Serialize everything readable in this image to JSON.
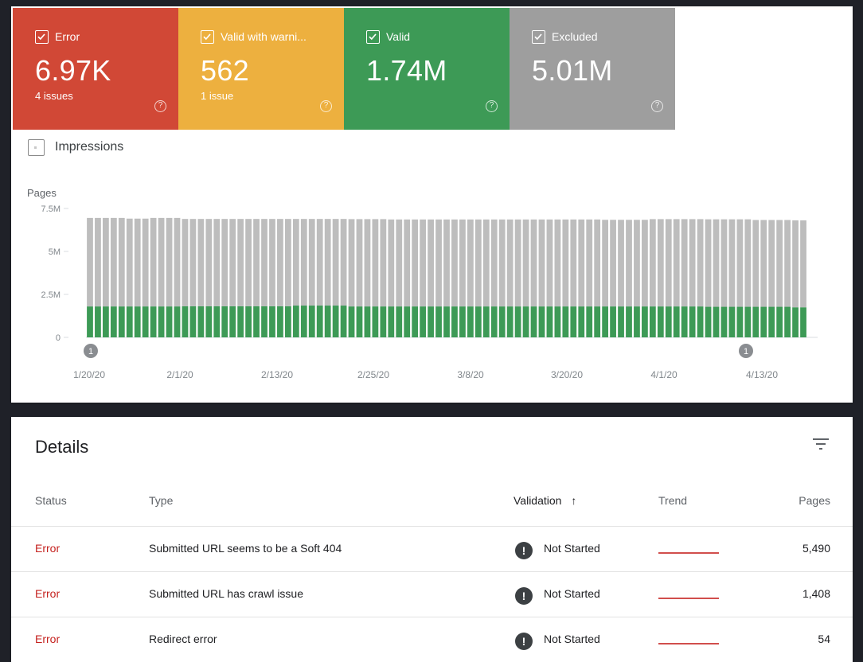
{
  "tiles": [
    {
      "label": "Error",
      "value": "6.97K",
      "sub": "4 issues",
      "color": "#d14836"
    },
    {
      "label": "Valid with warni...",
      "value": "562",
      "sub": "1 issue",
      "color": "#edb03f"
    },
    {
      "label": "Valid",
      "value": "1.74M",
      "sub": "",
      "color": "#3d9a56"
    },
    {
      "label": "Excluded",
      "value": "5.01M",
      "sub": "",
      "color": "#9e9e9e"
    }
  ],
  "impressions_label": "Impressions",
  "chart_data": {
    "type": "bar",
    "stacked": true,
    "ylabel": "Pages",
    "yticks": [
      "7.5M",
      "5M",
      "2.5M",
      "0"
    ],
    "ylim": [
      0,
      7500000
    ],
    "xtick_labels": [
      "1/20/20",
      "2/1/20",
      "2/13/20",
      "2/25/20",
      "3/8/20",
      "3/20/20",
      "4/1/20",
      "4/13/20"
    ],
    "annotation_markers": [
      "1",
      "1"
    ],
    "grid": false,
    "series": [
      {
        "color": "#3d9a56",
        "values": [
          1800000,
          1800000,
          1800000,
          1800000,
          1800000,
          1800000,
          1800000,
          1800000,
          1800000,
          1800000,
          1800000,
          1800000,
          1810000,
          1810000,
          1810000,
          1810000,
          1810000,
          1810000,
          1810000,
          1810000,
          1810000,
          1810000,
          1810000,
          1810000,
          1810000,
          1810000,
          1850000,
          1850000,
          1850000,
          1850000,
          1850000,
          1850000,
          1850000,
          1800000,
          1800000,
          1800000,
          1800000,
          1800000,
          1800000,
          1800000,
          1800000,
          1800000,
          1800000,
          1800000,
          1800000,
          1800000,
          1800000,
          1800000,
          1800000,
          1800000,
          1800000,
          1800000,
          1800000,
          1800000,
          1800000,
          1800000,
          1800000,
          1800000,
          1800000,
          1800000,
          1800000,
          1800000,
          1800000,
          1800000,
          1800000,
          1800000,
          1800000,
          1800000,
          1800000,
          1800000,
          1800000,
          1800000,
          1800000,
          1800000,
          1800000,
          1800000,
          1800000,
          1800000,
          1780000,
          1780000,
          1780000,
          1780000,
          1780000,
          1780000,
          1780000,
          1780000,
          1780000,
          1780000,
          1780000,
          1750000,
          1750000
        ]
      },
      {
        "color": "#bdbdbd",
        "values": [
          5150000,
          5150000,
          5150000,
          5150000,
          5150000,
          5110000,
          5110000,
          5110000,
          5150000,
          5150000,
          5150000,
          5150000,
          5080000,
          5080000,
          5080000,
          5080000,
          5080000,
          5080000,
          5080000,
          5080000,
          5080000,
          5080000,
          5080000,
          5080000,
          5080000,
          5080000,
          5040000,
          5040000,
          5040000,
          5040000,
          5040000,
          5040000,
          5040000,
          5080000,
          5080000,
          5080000,
          5080000,
          5080000,
          5060000,
          5060000,
          5060000,
          5060000,
          5060000,
          5060000,
          5060000,
          5060000,
          5060000,
          5060000,
          5060000,
          5060000,
          5060000,
          5060000,
          5060000,
          5060000,
          5060000,
          5060000,
          5060000,
          5060000,
          5060000,
          5060000,
          5060000,
          5060000,
          5060000,
          5060000,
          5060000,
          5040000,
          5040000,
          5040000,
          5040000,
          5040000,
          5040000,
          5080000,
          5080000,
          5080000,
          5080000,
          5080000,
          5080000,
          5080000,
          5090000,
          5090000,
          5090000,
          5090000,
          5090000,
          5090000,
          5050000,
          5050000,
          5050000,
          5050000,
          5050000,
          5060000,
          5060000
        ]
      }
    ]
  },
  "details": {
    "title": "Details",
    "columns": {
      "status": "Status",
      "type": "Type",
      "validation": "Validation",
      "sort_icon": "↑",
      "trend": "Trend",
      "pages": "Pages"
    },
    "rows": [
      {
        "status": "Error",
        "type": "Submitted URL seems to be a Soft 404",
        "validation_icon": "!",
        "validation": "Not Started",
        "pages": "5,490"
      },
      {
        "status": "Error",
        "type": "Submitted URL has crawl issue",
        "validation_icon": "!",
        "validation": "Not Started",
        "pages": "1,408"
      },
      {
        "status": "Error",
        "type": "Redirect error",
        "validation_icon": "!",
        "validation": "Not Started",
        "pages": "54"
      }
    ]
  }
}
